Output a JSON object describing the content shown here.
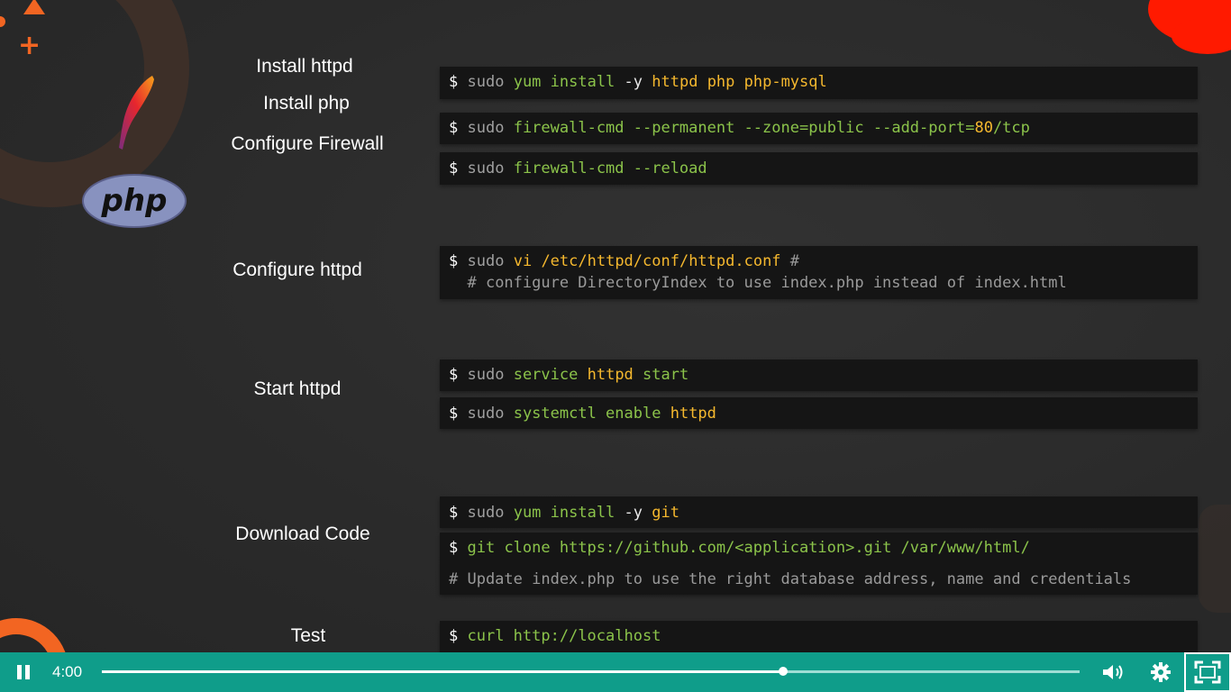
{
  "slide": {
    "labels": [
      {
        "text": "Install httpd"
      },
      {
        "text": "Install php"
      },
      {
        "text": "Configure Firewall"
      },
      {
        "text": "Configure httpd"
      },
      {
        "text": "Start httpd"
      },
      {
        "text": "Download Code"
      },
      {
        "text": "Test"
      }
    ],
    "logos": {
      "php_text": "php"
    },
    "code": {
      "b1": {
        "p": "$",
        "sudo": "sudo",
        "cmd": "yum install",
        "flag": "-y",
        "args": "httpd php php-mysql"
      },
      "b2": {
        "p": "$",
        "sudo": "sudo",
        "cmd": "firewall-cmd --permanent --zone=public --add-port=",
        "num": "80",
        "tail": "/tcp"
      },
      "b3": {
        "p": "$",
        "sudo": "sudo",
        "cmd": "firewall-cmd --reload"
      },
      "b4": {
        "p": "$",
        "sudo": "sudo",
        "cmd": "vi",
        "path": "/etc/httpd/conf/httpd.conf",
        "hash": "#",
        "comment": "# configure DirectoryIndex to use index.php instead of index.html"
      },
      "b5": {
        "p": "$",
        "sudo": "sudo",
        "cmd": "service",
        "svc": "httpd",
        "act": "start"
      },
      "b6": {
        "p": "$",
        "sudo": "sudo",
        "cmd": "systemctl enable",
        "svc": "httpd"
      },
      "b7": {
        "p": "$",
        "sudo": "sudo",
        "cmd": "yum install",
        "flag": "-y",
        "pkg": "git"
      },
      "b8": {
        "p": "$",
        "cmd": "git clone https://github.com/<application>.git /var/www/html/",
        "comment": "# Update index.php to use the right database address, name and credentials"
      },
      "b9": {
        "p": "$",
        "cmd": "curl http://localhost"
      }
    }
  },
  "player": {
    "time": "4:00",
    "progress_fraction": 0.697,
    "icons": {
      "pause": "pause-icon",
      "volume": "volume-icon",
      "settings": "gear-icon",
      "fullscreen": "fullscreen-icon"
    }
  },
  "colors": {
    "accent": "#f26522",
    "bar": "#0f9d8a",
    "green": "#8bc34a",
    "orange": "#f5b82e"
  }
}
